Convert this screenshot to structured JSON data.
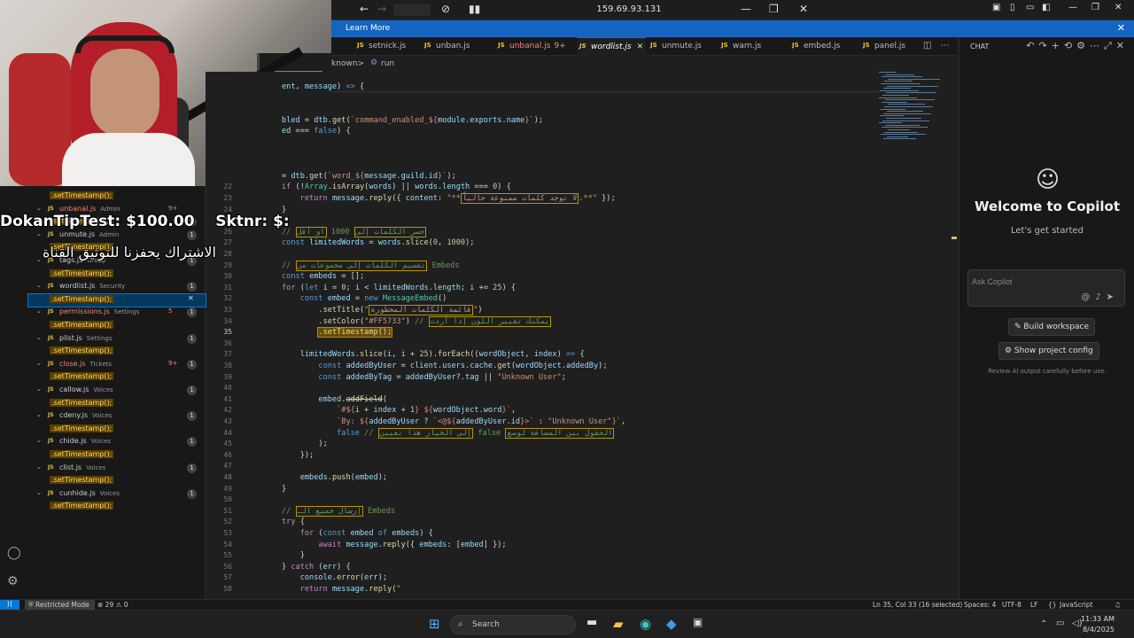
{
  "remote_bar": {
    "ip": "159.69.93.131"
  },
  "banner": {
    "learn_more": "Learn More"
  },
  "tabs": [
    {
      "label": "setnick.js",
      "count": ""
    },
    {
      "label": "unban.js",
      "count": ""
    },
    {
      "label": "unbanal.js",
      "count": "9+"
    },
    {
      "label": "wordlist.js",
      "count": ""
    },
    {
      "label": "unmute.js",
      "count": ""
    },
    {
      "label": "warn.js",
      "count": ""
    },
    {
      "label": "embed.js",
      "count": ""
    },
    {
      "label": "panel.js",
      "count": ""
    }
  ],
  "breadcrumb": {
    "left": "known>",
    "right": "run"
  },
  "overlay": {
    "tip": "DokanTipTest: $100.00",
    "tip2": "Sktnr: $:",
    "subtitle": "الاشتراك يحفزنا للتوثيق القناة"
  },
  "explorer": [
    {
      "type": "ts",
      "text": ".setTimestamp();",
      "badge": "",
      "rc": ""
    },
    {
      "type": "file",
      "name": "unbanal.js",
      "desc": "Admin",
      "badge": "",
      "rc": "9+",
      "red": true
    },
    {
      "type": "ts",
      "text": ".setTimestamp();",
      "badge": "1",
      "rc": ""
    },
    {
      "type": "file",
      "name": "unmute.js",
      "desc": "Admin",
      "badge": "1",
      "rc": ""
    },
    {
      "type": "ts",
      "text": ".setTimestamp();",
      "badge": "",
      "rc": ""
    },
    {
      "type": "file",
      "name": "tags.js",
      "desc": "Group",
      "badge": "1",
      "rc": ""
    },
    {
      "type": "ts",
      "text": ".setTimestamp();",
      "badge": "",
      "rc": ""
    },
    {
      "type": "file",
      "name": "wordlist.js",
      "desc": "Security",
      "badge": "1",
      "rc": ""
    },
    {
      "type": "ts",
      "text": ".setTimestamp();",
      "badge": "",
      "rc": "",
      "selected": true
    },
    {
      "type": "file",
      "name": "permissions.js",
      "desc": "Settings",
      "badge": "1",
      "rc": "5",
      "red": true
    },
    {
      "type": "ts",
      "text": ".setTimestamp();",
      "badge": "",
      "rc": ""
    },
    {
      "type": "file",
      "name": "plist.js",
      "desc": "Settings",
      "badge": "1",
      "rc": ""
    },
    {
      "type": "ts",
      "text": ".setTimestamp();",
      "badge": "",
      "rc": ""
    },
    {
      "type": "file",
      "name": "close.js",
      "desc": "Tickets",
      "badge": "1",
      "rc": "9+",
      "red": true
    },
    {
      "type": "ts",
      "text": ".setTimestamp();",
      "badge": "",
      "rc": ""
    },
    {
      "type": "file",
      "name": "callow.js",
      "desc": "Voices",
      "badge": "1",
      "rc": ""
    },
    {
      "type": "ts",
      "text": ".setTimestamp();",
      "badge": "",
      "rc": ""
    },
    {
      "type": "file",
      "name": "cdeny.js",
      "desc": "Voices",
      "badge": "1",
      "rc": ""
    },
    {
      "type": "ts",
      "text": ".setTimestamp();",
      "badge": "",
      "rc": ""
    },
    {
      "type": "file",
      "name": "chide.js",
      "desc": "Voices",
      "badge": "1",
      "rc": ""
    },
    {
      "type": "ts",
      "text": ".setTimestamp();",
      "badge": "",
      "rc": ""
    },
    {
      "type": "file",
      "name": "clist.js",
      "desc": "Voices",
      "badge": "1",
      "rc": ""
    },
    {
      "type": "ts",
      "text": ".setTimestamp();",
      "badge": "",
      "rc": ""
    },
    {
      "type": "file",
      "name": "cunhide.js",
      "desc": "Voices",
      "badge": "1",
      "rc": ""
    },
    {
      "type": "ts",
      "text": ".setTimestamp();",
      "badge": "",
      "rc": ""
    }
  ],
  "code": [
    {
      "n": "",
      "html": "<span class=\"vr\">ent</span>, <span class=\"vr\">message</span>) <span class=\"bl\">=&gt;</span> {"
    },
    {
      "n": "",
      "html": ""
    },
    {
      "n": "",
      "html": ""
    },
    {
      "n": "",
      "html": "<span class=\"vr\">bled</span> = <span class=\"vr\">dtb</span>.<span class=\"fn\">get</span>(<span class=\"st\">`command_enabled_${</span><span class=\"vr\">module</span>.<span class=\"vr\">exports</span>.<span class=\"vr\">name</span><span class=\"st\">}`</span>);"
    },
    {
      "n": "",
      "html": "<span class=\"vr\">ed</span> === <span class=\"bl\">false</span>) {"
    },
    {
      "n": "",
      "html": ""
    },
    {
      "n": "",
      "html": ""
    },
    {
      "n": "",
      "html": ""
    },
    {
      "n": "",
      "html": "= <span class=\"vr\">dtb</span>.<span class=\"fn\">get</span>(<span class=\"st\">`word_${</span><span class=\"vr\">message</span>.<span class=\"vr\">guild</span>.<span class=\"vr\">id</span><span class=\"st\">}`</span>);"
    },
    {
      "n": "22",
      "html": "<span class=\"kw\">if</span> (!<span class=\"cls\">Array</span>.<span class=\"fn\">isArray</span>(<span class=\"vr\">words</span>) || <span class=\"vr\">words</span>.<span class=\"vr\">length</span> === <span class=\"nu\">0</span>) {"
    },
    {
      "n": "23",
      "html": "    <span class=\"kw\">return</span> <span class=\"vr\">message</span>.<span class=\"fn\">reply</span>({ <span class=\"vr\">content</span>: <span class=\"st\">\"**<span class=\"ar\">لا توجد كلمات ممنوعة حالياً</span>.**\"</span> });"
    },
    {
      "n": "24",
      "html": "}"
    },
    {
      "n": "25",
      "html": ""
    },
    {
      "n": "26",
      "html": "<span class=\"cm\">// <span class=\"ar\">حصر الكلمات إلى</span> 1000 <span class=\"ar\">أو أقل</span></span>"
    },
    {
      "n": "27",
      "html": "<span class=\"bl\">const</span> <span class=\"vr\">limitedWords</span> = <span class=\"vr\">words</span>.<span class=\"fn\">slice</span>(<span class=\"nu\">0</span>, <span class=\"nu\">1000</span>);"
    },
    {
      "n": "28",
      "html": ""
    },
    {
      "n": "29",
      "html": "<span class=\"cm\">// <span class=\"ar\">تقسيم الكلمات إلى مجموعات من</span> Embeds</span>"
    },
    {
      "n": "30",
      "html": "<span class=\"bl\">const</span> <span class=\"vr\">embeds</span> = [];"
    },
    {
      "n": "31",
      "html": "<span class=\"kw\">for</span> (<span class=\"bl\">let</span> <span class=\"vr\">i</span> = <span class=\"nu\">0</span>; <span class=\"vr\">i</span> &lt; <span class=\"vr\">limitedWords</span>.<span class=\"vr\">length</span>; <span class=\"vr\">i</span> += <span class=\"nu\">25</span>) {"
    },
    {
      "n": "32",
      "html": "    <span class=\"bl\">const</span> <span class=\"vr\">embed</span> = <span class=\"bl\">new</span> <span class=\"cls\">MessageEmbed</span>()"
    },
    {
      "n": "33",
      "html": "        .<span class=\"fn\">setTitle</span>(<span class=\"st\">\"<span class=\"ar\">قائمة الكلمات المحظورة</span>\"</span>)"
    },
    {
      "n": "34",
      "html": "        .<span class=\"fn\">setColor</span>(<span class=\"st\">\"#FF5733\"</span>) <span class=\"cm\">// <span class=\"ar\">يمكنك تغيير اللون إذا أردت</span></span>"
    },
    {
      "n": "35",
      "html": "        <span class=\"hl\">.<span class=\"fn\">setTimestamp</span>();</span>"
    },
    {
      "n": "36",
      "html": ""
    },
    {
      "n": "37",
      "html": "    <span class=\"vr\">limitedWords</span>.<span class=\"fn\">slice</span>(<span class=\"vr\">i</span>, <span class=\"vr\">i</span> + <span class=\"nu\">25</span>).<span class=\"fn\">forEach</span>((<span class=\"vr\">wordObject</span>, <span class=\"vr\">index</span>) <span class=\"bl\">=&gt;</span> {"
    },
    {
      "n": "38",
      "html": "        <span class=\"bl\">const</span> <span class=\"vr\">addedByUser</span> = <span class=\"vr\">client</span>.<span class=\"vr\">users</span>.<span class=\"vr\">cache</span>.<span class=\"fn\">get</span>(<span class=\"vr\">wordObject</span>.<span class=\"vr\">addedBy</span>);"
    },
    {
      "n": "39",
      "html": "        <span class=\"bl\">const</span> <span class=\"vr\">addedByTag</span> = <span class=\"vr\">addedByUser</span>?.<span class=\"vr\">tag</span> || <span class=\"st\">\"Unknown User\"</span>;"
    },
    {
      "n": "40",
      "html": ""
    },
    {
      "n": "41",
      "html": "        <span class=\"vr\">embed</span>.<span class=\"fn\" style=\"text-decoration:line-through\">addField</span>("
    },
    {
      "n": "42",
      "html": "            <span class=\"st\">`#${</span><span class=\"vr\">i</span> + <span class=\"vr\">index</span> + <span class=\"nu\">1</span><span class=\"st\">} ${</span><span class=\"vr\">wordObject</span>.<span class=\"vr\">word</span><span class=\"st\">}`</span>,"
    },
    {
      "n": "43",
      "html": "            <span class=\"st\">`By: ${</span><span class=\"vr\">addedByUser</span> ? <span class=\"st\">`&lt;@${</span><span class=\"vr\">addedByUser</span>.<span class=\"vr\">id</span><span class=\"st\">}&gt;`</span> : <span class=\"st\">\"Unknown User\"</span><span class=\"st\">}`</span>,"
    },
    {
      "n": "44",
      "html": "            <span class=\"bl\">false</span> <span class=\"cm\">// <span class=\"ar\">إلى الخيار هذا تعيين</span> false <span class=\"ar\">الحقول بين المسافة لوضع</span></span>"
    },
    {
      "n": "45",
      "html": "        );"
    },
    {
      "n": "46",
      "html": "    });"
    },
    {
      "n": "47",
      "html": ""
    },
    {
      "n": "48",
      "html": "    <span class=\"vr\">embeds</span>.<span class=\"fn\">push</span>(<span class=\"vr\">embed</span>);"
    },
    {
      "n": "49",
      "html": "}"
    },
    {
      "n": "50",
      "html": ""
    },
    {
      "n": "51",
      "html": "<span class=\"cm\">// <span class=\"ar\">إرسال جميع الـ</span> Embeds</span>"
    },
    {
      "n": "52",
      "html": "<span class=\"kw\">try</span> {"
    },
    {
      "n": "53",
      "html": "    <span class=\"kw\">for</span> (<span class=\"bl\">const</span> <span class=\"vr\">embed</span> <span class=\"bl\">of</span> <span class=\"vr\">embeds</span>) {"
    },
    {
      "n": "54",
      "html": "        <span class=\"kw\">await</span> <span class=\"vr\">message</span>.<span class=\"fn\">reply</span>({ <span class=\"vr\">embeds</span>: [<span class=\"vr\">embed</span>] });"
    },
    {
      "n": "55",
      "html": "    }"
    },
    {
      "n": "56",
      "html": "} <span class=\"kw\">catch</span> (<span class=\"vr\">err</span>) {"
    },
    {
      "n": "57",
      "html": "    <span class=\"vr\">console</span>.<span class=\"fn\">error</span>(<span class=\"vr\">err</span>);"
    },
    {
      "n": "58",
      "html": "    <span class=\"kw\">return</span> <span class=\"vr\">message</span>.<span class=\"fn\">reply</span>(<span class=\"st\">\"</span>"
    }
  ],
  "current_line": "35",
  "chat": {
    "header": "CHAT",
    "welcome": "Welcome to Copilot",
    "subtitle": "Let's get started",
    "ask_placeholder": "Ask Copilot",
    "build_workspace": "Build workspace",
    "show_project_config": "Show project config",
    "review_note": "Review AI output carefully before use."
  },
  "status": {
    "restricted": "Restricted Mode",
    "problems": "⊗ 29 ⚠ 0",
    "position": "Ln 35, Col 33 (16 selected)",
    "spaces": "Spaces: 4",
    "encoding": "UTF-8",
    "eol": "LF",
    "language": "JavaScript"
  },
  "taskbar": {
    "search": "Search",
    "time": "11:33 AM",
    "date": "8/4/2025"
  },
  "colors": {
    "accent": "#0078d4",
    "banner": "#1565c0",
    "highlight": "#6b4b00"
  }
}
